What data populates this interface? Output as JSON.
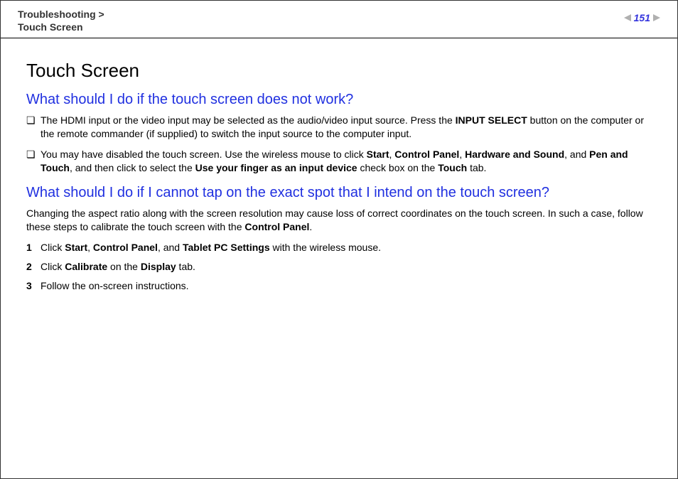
{
  "header": {
    "breadcrumb_section": "Troubleshooting",
    "breadcrumb_sep": " > ",
    "breadcrumb_page": "Touch Screen",
    "page_number": "151"
  },
  "content": {
    "title": "Touch Screen",
    "section1": {
      "heading": "What should I do if the touch screen does not work?",
      "bullets": [
        {
          "pre": "The HDMI input or the video input may be selected as the audio/video input source. Press the ",
          "b1": "INPUT SELECT",
          "post": " button on the computer or the remote commander (if supplied) to switch the input source to the computer input."
        },
        {
          "pre": "You may have disabled the touch screen. Use the wireless mouse to click ",
          "b1": "Start",
          "s1": ", ",
          "b2": "Control Panel",
          "s2": ", ",
          "b3": "Hardware and Sound",
          "s3": ", and ",
          "b4": "Pen and Touch",
          "s4": ", and then click to select the ",
          "b5": "Use your finger as an input device",
          "s5": " check box on the ",
          "b6": "Touch",
          "s6": " tab."
        }
      ]
    },
    "section2": {
      "heading": "What should I do if I cannot tap on the exact spot that I intend on the touch screen?",
      "para_pre": "Changing the aspect ratio along with the screen resolution may cause loss of correct coordinates on the touch screen. In such a case, follow these steps to calibrate the touch screen with the ",
      "para_b": "Control Panel",
      "para_post": ".",
      "steps": [
        {
          "n": "1",
          "pre": "Click ",
          "b1": "Start",
          "s1": ", ",
          "b2": "Control Panel",
          "s2": ", and ",
          "b3": "Tablet PC Settings",
          "s3": " with the wireless mouse."
        },
        {
          "n": "2",
          "pre": "Click ",
          "b1": "Calibrate",
          "s1": " on the ",
          "b2": "Display",
          "s2": " tab."
        },
        {
          "n": "3",
          "pre": "Follow the on-screen instructions."
        }
      ]
    }
  }
}
